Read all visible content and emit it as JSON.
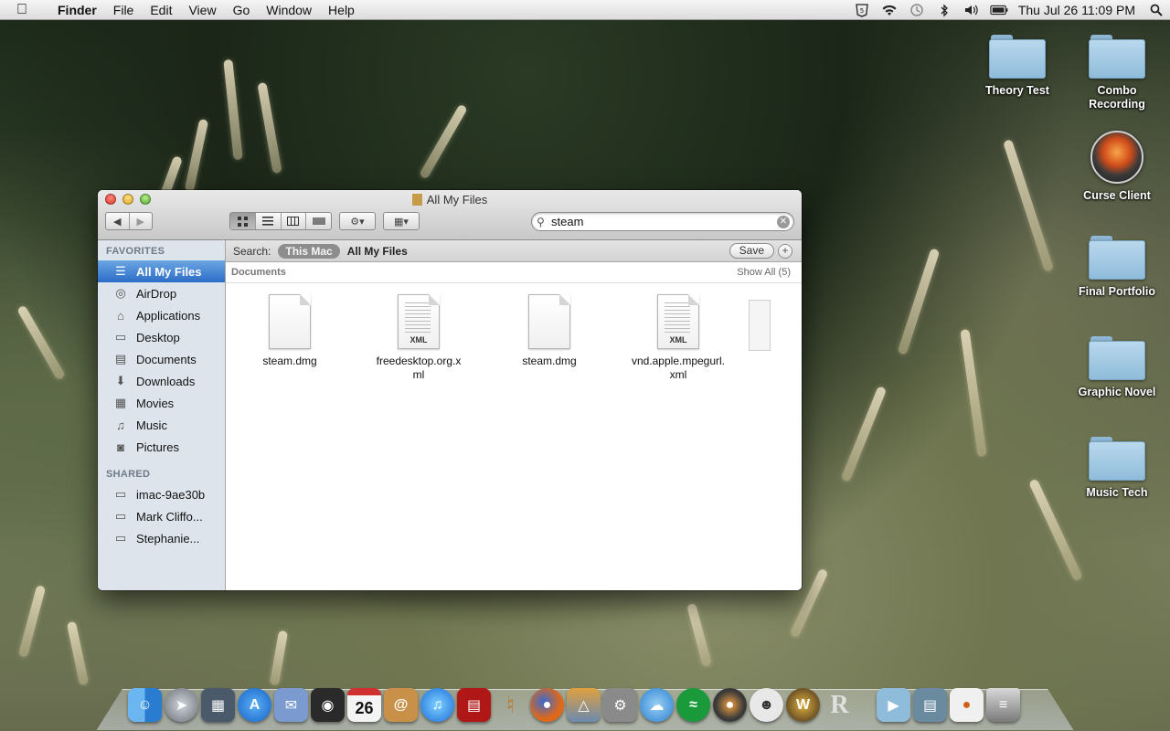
{
  "menubar": {
    "app_name": "Finder",
    "menus": [
      "File",
      "Edit",
      "View",
      "Go",
      "Window",
      "Help"
    ],
    "clock": "Thu Jul 26  11:09 PM"
  },
  "desktop_icons": [
    {
      "label": "Theory Test",
      "type": "folder"
    },
    {
      "label": "Combo Recording",
      "type": "folder"
    },
    {
      "label": "Curse Client",
      "type": "app"
    },
    {
      "label": "Final Portfolio",
      "type": "folder"
    },
    {
      "label": "Graphic Novel",
      "type": "folder"
    },
    {
      "label": "Music Tech",
      "type": "folder"
    }
  ],
  "window": {
    "title": "All My Files",
    "search_value": "steam",
    "sidebar": {
      "favorites_header": "FAVORITES",
      "favorites": [
        {
          "label": "All My Files",
          "icon": "all-files-icon",
          "glyph": "☰"
        },
        {
          "label": "AirDrop",
          "icon": "airdrop-icon",
          "glyph": "◎"
        },
        {
          "label": "Applications",
          "icon": "applications-icon",
          "glyph": "⌂"
        },
        {
          "label": "Desktop",
          "icon": "desktop-icon",
          "glyph": "▭"
        },
        {
          "label": "Documents",
          "icon": "documents-icon",
          "glyph": "▤"
        },
        {
          "label": "Downloads",
          "icon": "downloads-icon",
          "glyph": "⬇"
        },
        {
          "label": "Movies",
          "icon": "movies-icon",
          "glyph": "▦"
        },
        {
          "label": "Music",
          "icon": "music-icon",
          "glyph": "♫"
        },
        {
          "label": "Pictures",
          "icon": "pictures-icon",
          "glyph": "◙"
        }
      ],
      "shared_header": "SHARED",
      "shared": [
        {
          "label": "imac-9ae30b",
          "icon": "imac-icon",
          "glyph": "▭"
        },
        {
          "label": "Mark Cliffo...",
          "icon": "computer-icon",
          "glyph": "▭"
        },
        {
          "label": "Stephanie...",
          "icon": "laptop-icon",
          "glyph": "▭"
        }
      ]
    },
    "scopebar": {
      "label": "Search:",
      "this_mac": "This Mac",
      "all_my_files": "All My Files",
      "save": "Save"
    },
    "group": {
      "title": "Documents",
      "show_all": "Show All (5)"
    },
    "files": [
      {
        "name": "steam.dmg",
        "kind": "blank"
      },
      {
        "name": "freedesktop.org.x\nml",
        "kind": "xml"
      },
      {
        "name": "steam.dmg",
        "kind": "blank"
      },
      {
        "name": "vnd.apple.mpegurl.\nxml",
        "kind": "xml"
      }
    ],
    "xml_badge": "XML"
  },
  "dock": {
    "calendar_day": "26",
    "items": [
      {
        "name": "finder",
        "color": "#3b8de0"
      },
      {
        "name": "launchpad",
        "color": "#7a7f88"
      },
      {
        "name": "mission-control",
        "color": "#4a5a6a"
      },
      {
        "name": "app-store",
        "color": "#1d78e0"
      },
      {
        "name": "mail",
        "color": "#5a7ab0"
      },
      {
        "name": "facetime",
        "color": "#2a2a2a"
      },
      {
        "name": "ical",
        "color": "#f0f0f0"
      },
      {
        "name": "address-book",
        "color": "#c89048"
      },
      {
        "name": "itunes",
        "color": "#1a8ed8"
      },
      {
        "name": "dvd-player",
        "color": "#b01818"
      },
      {
        "name": "garageband",
        "color": "#b87a30"
      },
      {
        "name": "firefox",
        "color": "#e06818"
      },
      {
        "name": "iphoto",
        "color": "#6a8ab0"
      },
      {
        "name": "system-preferences",
        "color": "#8a8a8a"
      },
      {
        "name": "preview",
        "color": "#4aa0e0"
      },
      {
        "name": "spotify",
        "color": "#1a9a3a"
      },
      {
        "name": "curse",
        "color": "#555"
      },
      {
        "name": "skype",
        "color": "#e8e8e8"
      },
      {
        "name": "world-of-warcraft",
        "color": "#3a2a1a"
      },
      {
        "name": "r",
        "color": "#d0d0d0"
      },
      {
        "name": "applications-stack",
        "color": "#8fbcdb"
      },
      {
        "name": "documents-stack",
        "color": "#6a8aa0"
      },
      {
        "name": "downloads-stack",
        "color": "#f0f0f0"
      },
      {
        "name": "trash",
        "color": "#9a9a9a"
      }
    ]
  }
}
